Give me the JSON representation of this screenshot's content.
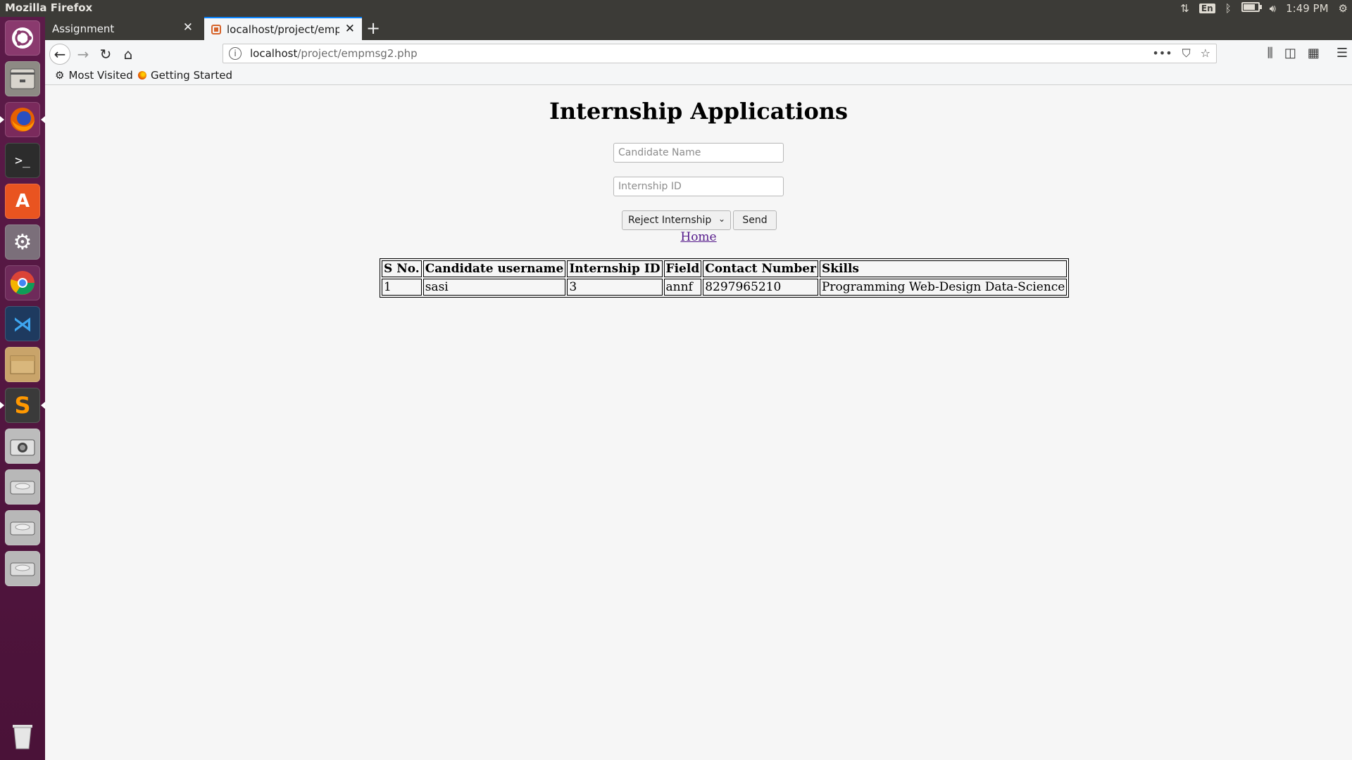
{
  "system": {
    "window_title": "Mozilla Firefox",
    "keyboard_layout": "En",
    "clock": "1:49 PM"
  },
  "launcher": {
    "items": [
      {
        "name": "ubuntu-dash-icon"
      },
      {
        "name": "files-icon"
      },
      {
        "name": "firefox-icon"
      },
      {
        "name": "terminal-icon"
      },
      {
        "name": "software-center-icon"
      },
      {
        "name": "system-settings-icon"
      },
      {
        "name": "chrome-icon"
      },
      {
        "name": "vscode-icon"
      },
      {
        "name": "archive-icon"
      },
      {
        "name": "sublime-text-icon"
      },
      {
        "name": "camera-icon"
      },
      {
        "name": "drive-icon"
      },
      {
        "name": "drive-icon"
      },
      {
        "name": "drive-icon"
      },
      {
        "name": "trash-icon"
      }
    ]
  },
  "browser": {
    "tabs": [
      {
        "label": "Assignment"
      },
      {
        "label": "localhost/project/empm"
      }
    ],
    "url_host": "localhost",
    "url_path": "/project/empmsg2.php",
    "bookmarks": [
      "Most Visited",
      "Getting Started"
    ]
  },
  "page": {
    "title": "Internship Applications",
    "candidate_placeholder": "Candidate Name",
    "internship_placeholder": "Internship ID",
    "action_selected": "Reject Internship",
    "send_label": "Send",
    "home_link": "Home",
    "table": {
      "headers": [
        "S No.",
        "Candidate username",
        "Internship ID",
        "Field",
        "Contact Number",
        "Skills"
      ],
      "rows": [
        [
          "1",
          "sasi",
          "3",
          "annf",
          "8297965210",
          "Programming Web-Design Data-Science"
        ]
      ]
    }
  },
  "colors": {
    "panel": "#3c3b37",
    "launcher": "#5c1b49",
    "accent": "#0a84ff",
    "link_visited": "#551a8b"
  }
}
